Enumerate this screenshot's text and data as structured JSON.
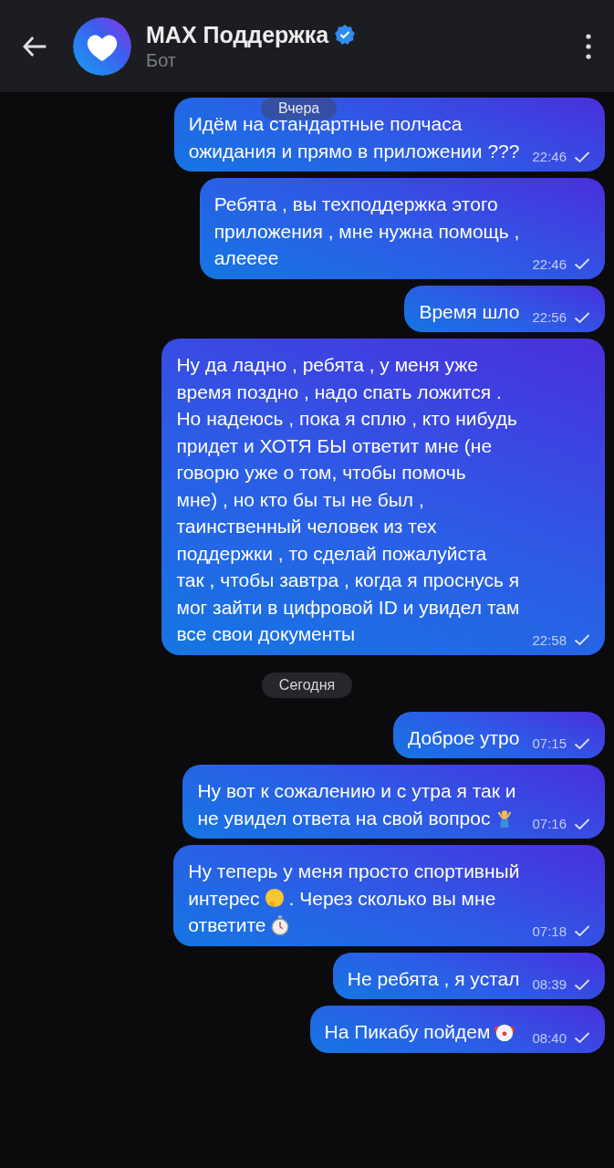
{
  "header": {
    "title": "MAX Поддержка",
    "subtitle": "Бот",
    "verified": true
  },
  "floating_date": "Вчера",
  "items": [
    {
      "kind": "message",
      "lines": [
        [
          {
            "kind": "text",
            "text": "Идём на стандартные полчаса"
          }
        ],
        [
          {
            "kind": "text",
            "text": "ожидания и прямо в приложении ???"
          }
        ]
      ],
      "time": "22:46"
    },
    {
      "kind": "message",
      "lines": [
        [
          {
            "kind": "text",
            "text": "Ребята , вы техподдержка этого"
          }
        ],
        [
          {
            "kind": "text",
            "text": "приложения , мне нужна помощь ,"
          }
        ],
        [
          {
            "kind": "text",
            "text": "алееее"
          }
        ]
      ],
      "time": "22:46"
    },
    {
      "kind": "message",
      "lines": [
        [
          {
            "kind": "text",
            "text": "Время шло"
          }
        ]
      ],
      "time": "22:56"
    },
    {
      "kind": "message",
      "lines": [
        [
          {
            "kind": "text",
            "text": "Ну да ладно , ребята , у меня уже"
          }
        ],
        [
          {
            "kind": "text",
            "text": "время поздно , надо спать ложится ."
          }
        ],
        [
          {
            "kind": "text",
            "text": "Но надеюсь , пока я сплю , кто нибудь"
          }
        ],
        [
          {
            "kind": "text",
            "text": "придет и ХОТЯ БЫ ответит мне (не"
          }
        ],
        [
          {
            "kind": "text",
            "text": "говорю уже о том, чтобы помочь"
          }
        ],
        [
          {
            "kind": "text",
            "text": "мне) , но кто бы ты не был ,"
          }
        ],
        [
          {
            "kind": "text",
            "text": "таинственный человек из тех"
          }
        ],
        [
          {
            "kind": "text",
            "text": "поддержки , то сделай пожалуйста"
          }
        ],
        [
          {
            "kind": "text",
            "text": "так , чтобы завтра , когда я проснусь я"
          }
        ],
        [
          {
            "kind": "text",
            "text": "мог зайти в цифровой ID и увидел там"
          }
        ],
        [
          {
            "kind": "text",
            "text": "все свои документы"
          }
        ]
      ],
      "time": "22:58"
    },
    {
      "kind": "date",
      "text": "Сегодня"
    },
    {
      "kind": "message",
      "lines": [
        [
          {
            "kind": "text",
            "text": "Доброе утро"
          }
        ]
      ],
      "time": "07:15"
    },
    {
      "kind": "message",
      "lines": [
        [
          {
            "kind": "text",
            "text": "Ну вот к сожалению и с утра я так и"
          }
        ],
        [
          {
            "kind": "text",
            "text": "не увидел ответа на свой вопрос"
          },
          {
            "kind": "shrug"
          }
        ]
      ],
      "time": "07:16"
    },
    {
      "kind": "message",
      "lines": [
        [
          {
            "kind": "text",
            "text": "Ну теперь у меня просто спортивный"
          }
        ],
        [
          {
            "kind": "text",
            "text": "интерес"
          },
          {
            "kind": "thinking"
          },
          {
            "kind": "text",
            "text": ". Через сколько вы мне"
          }
        ],
        [
          {
            "kind": "text",
            "text": "ответите"
          },
          {
            "kind": "stopwatch"
          }
        ]
      ],
      "time": "07:18"
    },
    {
      "kind": "message",
      "lines": [
        [
          {
            "kind": "text",
            "text": "Не ребята , я устал"
          }
        ]
      ],
      "time": "08:39"
    },
    {
      "kind": "message",
      "lines": [
        [
          {
            "kind": "text",
            "text": "На Пикабу пойдем"
          },
          {
            "kind": "clown"
          }
        ]
      ],
      "time": "08:40"
    }
  ]
}
